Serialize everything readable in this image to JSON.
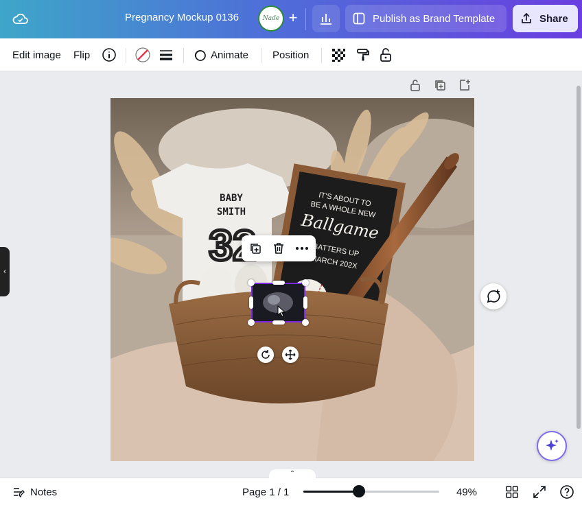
{
  "topbar": {
    "doc_title": "Pregnancy Mockup 0136",
    "brand_logo_text": "Nade",
    "add_label": "+",
    "publish_label": "Publish as Brand Template",
    "share_label": "Share"
  },
  "toolbar": {
    "edit_image": "Edit image",
    "flip": "Flip",
    "animate": "Animate",
    "position": "Position"
  },
  "photo": {
    "onesie_line1": "BABY",
    "onesie_line2": "SMITH",
    "onesie_number": "32",
    "board_line1": "IT'S ABOUT TO",
    "board_line2": "BE A WHOLE NEW",
    "board_line3": "Ballgame",
    "board_line4": "BATTERS UP",
    "board_line5": "MARCH 202X"
  },
  "footer": {
    "notes": "Notes",
    "page": "Page 1 / 1",
    "zoom": "49%",
    "zoom_level": 0.41,
    "collapse_glyph": "⌃"
  },
  "left_tab_glyph": "‹"
}
